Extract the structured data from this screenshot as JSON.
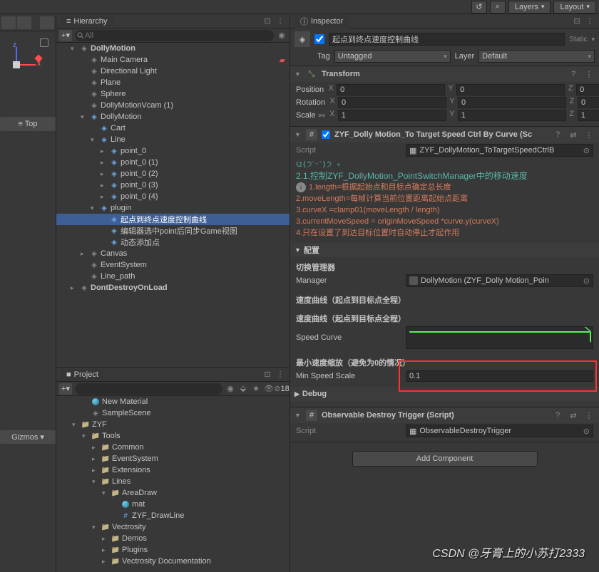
{
  "topbar": {
    "layers": "Layers",
    "layout": "Layout"
  },
  "leftPanel": {
    "axisX": "x",
    "axisY": "z",
    "persp": "≡ Top",
    "gizmos": "Gizmos"
  },
  "hierarchy": {
    "title": "Hierarchy",
    "searchPlaceholder": "All",
    "items": [
      {
        "depth": 0,
        "icon": "cube",
        "label": "DollyMotion",
        "arrow": "▾",
        "bold": true
      },
      {
        "depth": 1,
        "icon": "cube",
        "label": "Main Camera"
      },
      {
        "depth": 1,
        "icon": "cube",
        "label": "Directional Light"
      },
      {
        "depth": 1,
        "icon": "cube",
        "label": "Plane",
        "disabled": true
      },
      {
        "depth": 1,
        "icon": "cube",
        "label": "Sphere"
      },
      {
        "depth": 1,
        "icon": "cube",
        "label": "DollyMotionVcam (1)"
      },
      {
        "depth": 1,
        "icon": "pref",
        "label": "DollyMotion",
        "arrow": "▾"
      },
      {
        "depth": 2,
        "icon": "pref",
        "label": "Cart"
      },
      {
        "depth": 2,
        "icon": "pref",
        "label": "Line",
        "arrow": "▾"
      },
      {
        "depth": 3,
        "icon": "pref",
        "label": "point_0",
        "arrow": "▸"
      },
      {
        "depth": 3,
        "icon": "pref",
        "label": "point_0  (1)",
        "arrow": "▸"
      },
      {
        "depth": 3,
        "icon": "pref",
        "label": "point_0  (2)",
        "arrow": "▸"
      },
      {
        "depth": 3,
        "icon": "pref",
        "label": "point_0  (3)",
        "arrow": "▸"
      },
      {
        "depth": 3,
        "icon": "pref",
        "label": "point_0  (4)",
        "arrow": "▸"
      },
      {
        "depth": 2,
        "icon": "pref",
        "label": "plugin",
        "arrow": "▾"
      },
      {
        "depth": 3,
        "icon": "pref",
        "label": "起点到终点速度控制曲线",
        "selected": true
      },
      {
        "depth": 3,
        "icon": "pref",
        "label": "编辑器选中point后同步Game视图"
      },
      {
        "depth": 3,
        "icon": "pref",
        "label": "动态添加点"
      },
      {
        "depth": 1,
        "icon": "cube",
        "label": "Canvas",
        "arrow": "▸"
      },
      {
        "depth": 1,
        "icon": "cube",
        "label": "EventSystem"
      },
      {
        "depth": 1,
        "icon": "cube",
        "label": "Line_path"
      },
      {
        "depth": 0,
        "icon": "cube",
        "label": "DontDestroyOnLoad",
        "arrow": "▸",
        "bold": true
      }
    ]
  },
  "project": {
    "title": "Project",
    "searchPlaceholder": "",
    "countBadge": "18",
    "items": [
      {
        "depth": 2,
        "icon": "mat",
        "label": "New Material"
      },
      {
        "depth": 2,
        "icon": "scene",
        "label": "SampleScene"
      },
      {
        "depth": 1,
        "icon": "folder",
        "label": "ZYF",
        "arrow": "▾"
      },
      {
        "depth": 2,
        "icon": "folder",
        "label": "Tools",
        "arrow": "▾"
      },
      {
        "depth": 3,
        "icon": "folder",
        "label": "Common",
        "arrow": "▸"
      },
      {
        "depth": 3,
        "icon": "folder",
        "label": "EventSystem",
        "arrow": "▸"
      },
      {
        "depth": 3,
        "icon": "folder",
        "label": "Extensions",
        "arrow": "▸"
      },
      {
        "depth": 3,
        "icon": "folder",
        "label": "Lines",
        "arrow": "▾"
      },
      {
        "depth": 4,
        "icon": "folder",
        "label": "AreaDraw",
        "arrow": "▾"
      },
      {
        "depth": 5,
        "icon": "mat",
        "label": "mat"
      },
      {
        "depth": 5,
        "icon": "cs",
        "label": "ZYF_DrawLine"
      },
      {
        "depth": 3,
        "icon": "folder",
        "label": "Vectrosity",
        "arrow": "▾"
      },
      {
        "depth": 4,
        "icon": "folder",
        "label": "Demos",
        "arrow": "▸"
      },
      {
        "depth": 4,
        "icon": "folder",
        "label": "Plugins",
        "arrow": "▸"
      },
      {
        "depth": 4,
        "icon": "folder",
        "label": "Vectrosity Documentation",
        "arrow": "▸"
      }
    ]
  },
  "inspector": {
    "title": "Inspector",
    "objectName": "起点到终点速度控制曲线",
    "staticLabel": "Static",
    "tagLabel": "Tag",
    "tagValue": "Untagged",
    "layerLabel": "Layer",
    "layerValue": "Default",
    "transform": {
      "title": "Transform",
      "position": {
        "label": "Position",
        "x": "0",
        "y": "0",
        "z": "0"
      },
      "rotation": {
        "label": "Rotation",
        "x": "0",
        "y": "0",
        "z": "0"
      },
      "scale": {
        "label": "Scale",
        "x": "1",
        "y": "1",
        "z": "1"
      }
    },
    "script1": {
      "title": "ZYF_Dolly Motion_To Target Speed Ctrl By Curve (Sc",
      "scriptLabel": "Script",
      "scriptValue": "ZYF_DollyMotion_ToTargetSpeedCtrlB",
      "decor": "ଘ(੭ˊᵕˋ)੭ ✧",
      "descTitle": "2.1.控制ZYF_DollyMotion_PointSwitchManager中的移动速度",
      "lines": [
        "1.length=根据起始点和目标点确定总长度",
        "2.moveLength=每帧计算当前位置距离起始点距离",
        "3.curveX =clamp01(moveLength / length)",
        "3.currentMoveSpeed = originMoveSpeed *curve.y(curveX)",
        "4.只在设置了到达目标位置时自动停止才起作用"
      ],
      "configHdr": "配置",
      "mgrSection": "切换管理器",
      "mgrLabel": "Manager",
      "mgrValue": "DollyMotion (ZYF_Dolly Motion_Poin",
      "curveSection1": "速度曲线（起点到目标点全程）",
      "curveSection2": "速度曲线（起点到目标点全程）",
      "curveLabel": "Speed Curve",
      "minSection": "最小速度缩放（避免为0的情况）",
      "minLabel": "Min Speed Scale",
      "minValue": "0.1",
      "debug": "Debug"
    },
    "script2": {
      "title": "Observable Destroy Trigger (Script)",
      "scriptLabel": "Script",
      "scriptValue": "ObservableDestroyTrigger"
    },
    "addComponent": "Add Component"
  },
  "watermark": "CSDN @牙膏上的小苏打2333"
}
